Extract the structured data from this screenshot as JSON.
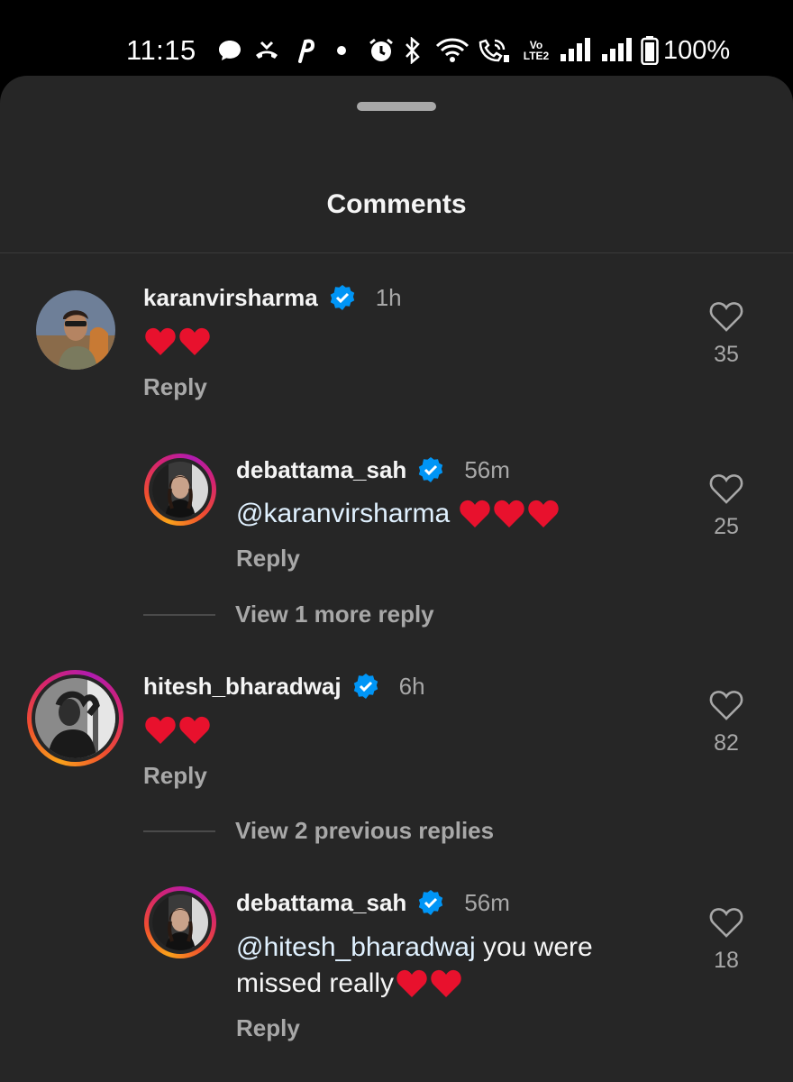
{
  "status_bar": {
    "time": "11:15",
    "battery_percent": "100%",
    "icons": [
      "chat-bubble-icon",
      "missed-call-icon",
      "app-notification-icon",
      "dot-icon",
      "alarm-icon",
      "bluetooth-icon",
      "wifi-icon",
      "wifi-call-icon",
      "volte-icon",
      "signal-1-icon",
      "signal-2-icon",
      "battery-icon"
    ],
    "volte_label": "Vo LTE2"
  },
  "sheet": {
    "title": "Comments"
  },
  "comments": [
    {
      "username": "karanvirsharma",
      "verified": true,
      "time": "1h",
      "text": "",
      "hearts": 2,
      "reply_label": "Reply",
      "likes": "35"
    },
    {
      "username": "debattama_sah",
      "verified": true,
      "time": "56m",
      "mention": "@karanvirsharma",
      "text": "",
      "hearts": 3,
      "reply_label": "Reply",
      "likes": "25"
    },
    {
      "username": "hitesh_bharadwaj",
      "verified": true,
      "time": "6h",
      "text": "",
      "hearts": 2,
      "reply_label": "Reply",
      "likes": "82"
    },
    {
      "username": "debattama_sah",
      "verified": true,
      "time": "56m",
      "mention": "@hitesh_bharadwaj",
      "text_line1": " you were",
      "text_line2": "missed really",
      "hearts": 2,
      "reply_label": "Reply",
      "likes": "18"
    }
  ],
  "view_more": [
    {
      "label": "View 1 more reply"
    },
    {
      "label": "View 2 previous replies"
    }
  ],
  "colors": {
    "sheet_bg": "#262626",
    "verified_blue": "#0095f6",
    "heart_red": "#e8112d",
    "secondary_text": "#a8a8a8"
  }
}
